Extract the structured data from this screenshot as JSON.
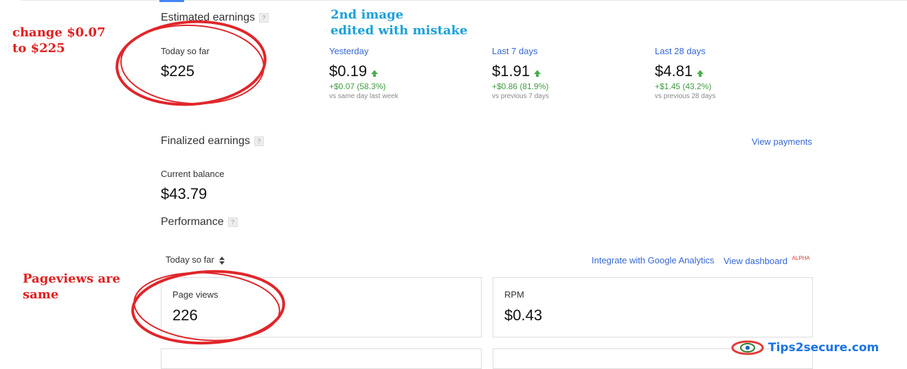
{
  "annotations": {
    "change_line1": "change $0.07",
    "change_line2": "to $225",
    "second_image_line1": "2nd image",
    "second_image_line2": "edited with mistake",
    "pageviews_line1": "Pageviews are",
    "pageviews_line2": "same"
  },
  "estimated": {
    "title": "Estimated earnings",
    "help": "?",
    "today": {
      "label": "Today so far",
      "value": "$225"
    },
    "yesterday": {
      "label": "Yesterday",
      "value": "$0.19",
      "delta": "+$0.07 (58.3%)",
      "note": "vs same day last week"
    },
    "last7": {
      "label": "Last 7 days",
      "value": "$1.91",
      "delta": "+$0.86 (81.9%)",
      "note": "vs previous 7 days"
    },
    "last28": {
      "label": "Last 28 days",
      "value": "$4.81",
      "delta": "+$1.45 (43.2%)",
      "note": "vs previous 28 days"
    }
  },
  "finalized": {
    "title": "Finalized earnings",
    "help": "?",
    "view_payments": "View payments",
    "balance_label": "Current balance",
    "balance_value": "$43.79"
  },
  "performance": {
    "title": "Performance",
    "help": "?",
    "range_selector": "Today so far",
    "integrate_link": "Integrate with Google Analytics",
    "dashboard_link": "View dashboard",
    "dashboard_badge": "ALPHA",
    "cards": [
      {
        "label": "Page views",
        "value": "226"
      },
      {
        "label": "RPM",
        "value": "$0.43"
      }
    ]
  },
  "watermark": {
    "text": "Tips2secure.com"
  },
  "colors": {
    "link": "#3367d6",
    "positive": "#3f9a3f",
    "annotation_red": "#e02020",
    "annotation_blue": "#1aa0d8",
    "ellipse": "#e0262a"
  }
}
